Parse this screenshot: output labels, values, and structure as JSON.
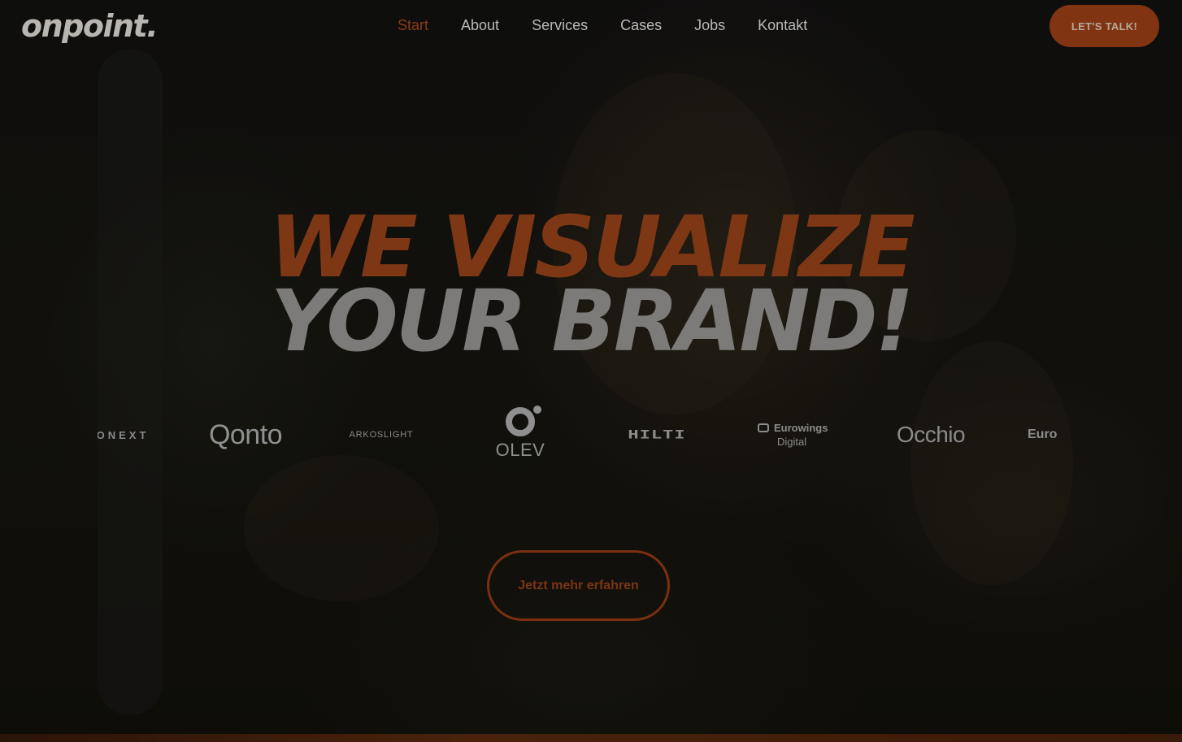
{
  "brand": {
    "logo_text": "onpoint."
  },
  "nav": {
    "items": [
      {
        "label": "Start",
        "active": true
      },
      {
        "label": "About"
      },
      {
        "label": "Services"
      },
      {
        "label": "Cases"
      },
      {
        "label": "Jobs"
      },
      {
        "label": "Kontakt"
      }
    ]
  },
  "header": {
    "cta_label": "LET'S TALK!"
  },
  "hero": {
    "line1": "WE VISUALIZE",
    "line2": "YOUR BRAND!"
  },
  "clients": {
    "logos": [
      {
        "name": "ONEXT"
      },
      {
        "name": "Qonto"
      },
      {
        "name": "ARKOSLIGHT"
      },
      {
        "name": "OLEV"
      },
      {
        "name": "HILTI"
      },
      {
        "name": "Eurowings",
        "sub": "Digital"
      },
      {
        "name": "Occhio"
      },
      {
        "name": "Euro"
      }
    ]
  },
  "main": {
    "cta_label": "Jetzt mehr erfahren"
  },
  "colors": {
    "accent": "#8c3a14",
    "hero_primary": "#7e3714",
    "hero_secondary": "#7c7b7a"
  }
}
